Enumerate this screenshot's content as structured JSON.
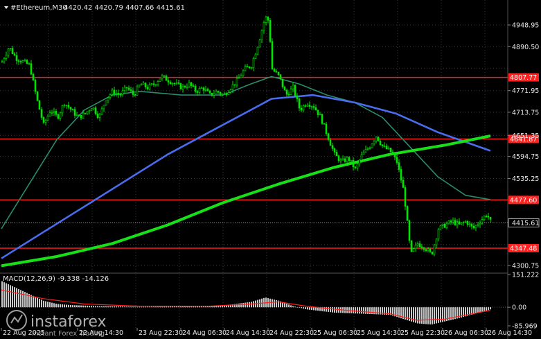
{
  "header": {
    "symbol": "#Ethereum,M30",
    "ohlc": "4420.42 4420.79 4407.66 4415.61"
  },
  "colors": {
    "background": "#000000",
    "candle": "#00e400",
    "grid": "#3a3a3a",
    "level_line": "#ff2020",
    "ma_fast": "#2a8c6a",
    "ma_mid": "#4a6df0",
    "ma_slow": "#18e018",
    "macd_hist": "#c8c8c8",
    "macd_signal": "#ff2020"
  },
  "price_axis": {
    "ticks": [
      "4948.95",
      "4890.50",
      "4771.95",
      "4713.75",
      "4651.35",
      "4594.75",
      "4535.25",
      "4415.61",
      "4300.75"
    ],
    "current_price": "4415.61"
  },
  "levels": [
    {
      "value": 4807.77,
      "label": "4807.77"
    },
    {
      "value": 4641.87,
      "label": "4641.87"
    },
    {
      "value": 4477.6,
      "label": "4477.60"
    },
    {
      "value": 4347.48,
      "label": "4347.48"
    }
  ],
  "time_axis": {
    "labels": [
      "22 Aug 2025",
      "22 Aug 14:30",
      "23 Aug 22:30",
      "24 Aug 06:30",
      "24 Aug 14:30",
      "24 Aug 22:30",
      "25 Aug 06:30",
      "25 Aug 14:30",
      "25 Aug 22:30",
      "26 Aug 06:30",
      "26 Aug 14:30"
    ]
  },
  "macd": {
    "label": "MACD(12,26,9) -9.338 -14.126",
    "ticks": [
      "151.222",
      "0.00",
      "-85.969"
    ]
  },
  "watermark": {
    "brand": "instaforex",
    "tagline": "Instant Forex Trading"
  },
  "chart_data": {
    "type": "candlestick",
    "title": "#Ethereum,M30",
    "ylim": [
      4300,
      4990
    ],
    "close_path": [
      [
        0,
        4850
      ],
      [
        10,
        4890
      ],
      [
        20,
        4860
      ],
      [
        30,
        4850
      ],
      [
        40,
        4840
      ],
      [
        50,
        4750
      ],
      [
        60,
        4680
      ],
      [
        70,
        4720
      ],
      [
        80,
        4700
      ],
      [
        90,
        4740
      ],
      [
        100,
        4720
      ],
      [
        110,
        4700
      ],
      [
        120,
        4710
      ],
      [
        130,
        4730
      ],
      [
        140,
        4700
      ],
      [
        150,
        4750
      ],
      [
        160,
        4770
      ],
      [
        170,
        4760
      ],
      [
        180,
        4780
      ],
      [
        190,
        4760
      ],
      [
        200,
        4790
      ],
      [
        210,
        4780
      ],
      [
        220,
        4790
      ],
      [
        230,
        4810
      ],
      [
        240,
        4800
      ],
      [
        250,
        4790
      ],
      [
        260,
        4780
      ],
      [
        270,
        4790
      ],
      [
        280,
        4770
      ],
      [
        290,
        4780
      ],
      [
        300,
        4760
      ],
      [
        310,
        4770
      ],
      [
        320,
        4760
      ],
      [
        330,
        4780
      ],
      [
        340,
        4800
      ],
      [
        350,
        4830
      ],
      [
        360,
        4840
      ],
      [
        370,
        4900
      ],
      [
        380,
        4970
      ],
      [
        385,
        4960
      ],
      [
        390,
        4830
      ],
      [
        400,
        4810
      ],
      [
        410,
        4760
      ],
      [
        420,
        4780
      ],
      [
        430,
        4720
      ],
      [
        440,
        4740
      ],
      [
        450,
        4730
      ],
      [
        460,
        4700
      ],
      [
        470,
        4650
      ],
      [
        480,
        4600
      ],
      [
        490,
        4580
      ],
      [
        500,
        4590
      ],
      [
        510,
        4560
      ],
      [
        520,
        4600
      ],
      [
        530,
        4620
      ],
      [
        540,
        4650
      ],
      [
        550,
        4620
      ],
      [
        560,
        4610
      ],
      [
        570,
        4580
      ],
      [
        580,
        4500
      ],
      [
        590,
        4330
      ],
      [
        600,
        4360
      ],
      [
        610,
        4350
      ],
      [
        620,
        4330
      ],
      [
        630,
        4400
      ],
      [
        640,
        4410
      ],
      [
        650,
        4420
      ],
      [
        660,
        4410
      ],
      [
        670,
        4420
      ],
      [
        680,
        4400
      ],
      [
        690,
        4420
      ],
      [
        700,
        4440
      ],
      [
        706,
        4415
      ]
    ],
    "ma_fast": [
      [
        0,
        4400
      ],
      [
        40,
        4520
      ],
      [
        80,
        4640
      ],
      [
        120,
        4720
      ],
      [
        160,
        4760
      ],
      [
        200,
        4770
      ],
      [
        260,
        4760
      ],
      [
        320,
        4760
      ],
      [
        360,
        4790
      ],
      [
        390,
        4810
      ],
      [
        430,
        4790
      ],
      [
        470,
        4760
      ],
      [
        510,
        4740
      ],
      [
        550,
        4700
      ],
      [
        590,
        4620
      ],
      [
        630,
        4540
      ],
      [
        670,
        4490
      ],
      [
        706,
        4478
      ]
    ],
    "ma_mid": [
      [
        0,
        4320
      ],
      [
        60,
        4390
      ],
      [
        120,
        4460
      ],
      [
        180,
        4530
      ],
      [
        240,
        4600
      ],
      [
        300,
        4660
      ],
      [
        360,
        4720
      ],
      [
        390,
        4750
      ],
      [
        450,
        4760
      ],
      [
        510,
        4740
      ],
      [
        570,
        4710
      ],
      [
        630,
        4660
      ],
      [
        706,
        4610
      ]
    ],
    "ma_slow": [
      [
        0,
        4300
      ],
      [
        80,
        4325
      ],
      [
        160,
        4360
      ],
      [
        240,
        4410
      ],
      [
        320,
        4470
      ],
      [
        400,
        4520
      ],
      [
        480,
        4565
      ],
      [
        560,
        4600
      ],
      [
        640,
        4625
      ],
      [
        706,
        4650
      ]
    ],
    "macd_hist": [
      [
        0,
        120
      ],
      [
        20,
        90
      ],
      [
        40,
        60
      ],
      [
        60,
        30
      ],
      [
        80,
        15
      ],
      [
        100,
        10
      ],
      [
        140,
        5
      ],
      [
        200,
        2
      ],
      [
        260,
        4
      ],
      [
        320,
        8
      ],
      [
        360,
        25
      ],
      [
        380,
        45
      ],
      [
        400,
        30
      ],
      [
        420,
        5
      ],
      [
        440,
        -10
      ],
      [
        480,
        -25
      ],
      [
        520,
        -30
      ],
      [
        560,
        -35
      ],
      [
        600,
        -75
      ],
      [
        620,
        -80
      ],
      [
        660,
        -50
      ],
      [
        700,
        -15
      ],
      [
        706,
        -9
      ]
    ],
    "macd_signal": [
      [
        0,
        80
      ],
      [
        60,
        40
      ],
      [
        120,
        15
      ],
      [
        200,
        5
      ],
      [
        300,
        5
      ],
      [
        360,
        15
      ],
      [
        400,
        25
      ],
      [
        440,
        5
      ],
      [
        500,
        -15
      ],
      [
        560,
        -30
      ],
      [
        600,
        -60
      ],
      [
        640,
        -55
      ],
      [
        706,
        -14
      ]
    ]
  }
}
